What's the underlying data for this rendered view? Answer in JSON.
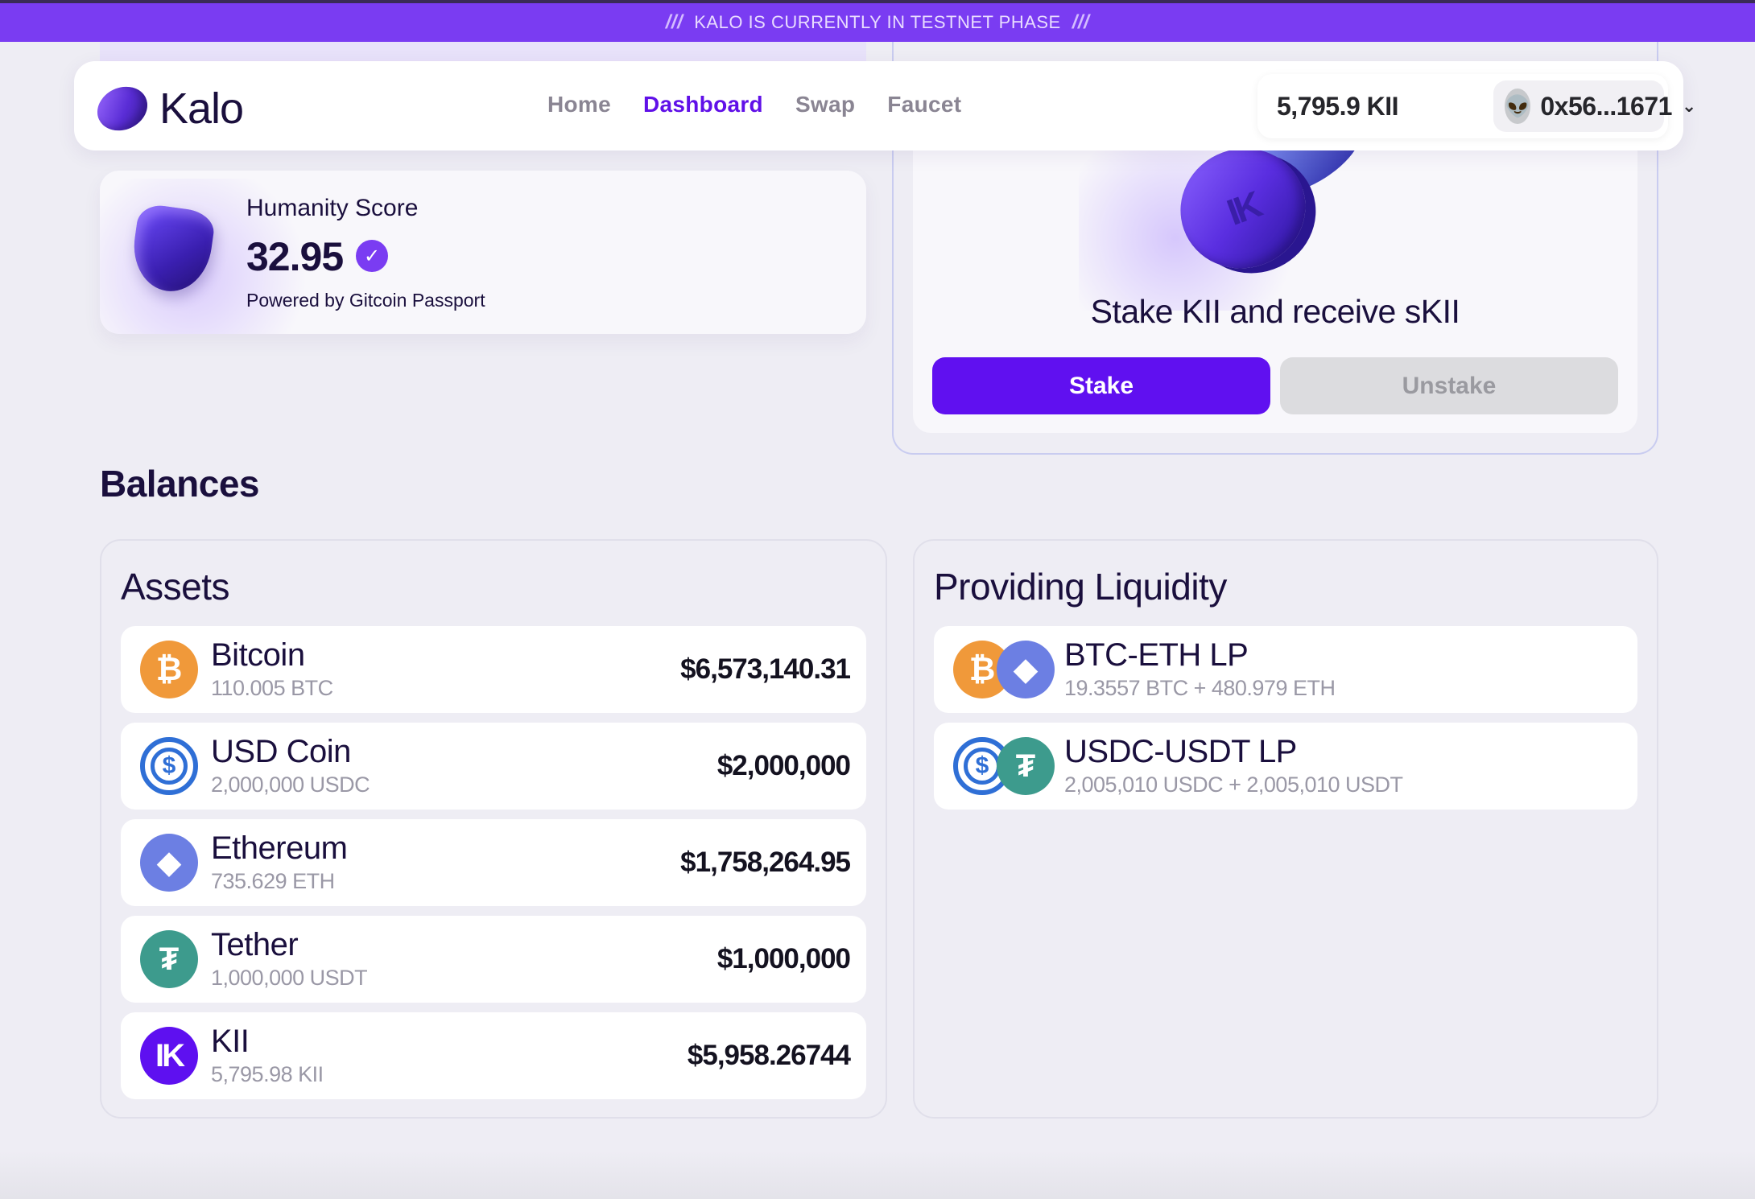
{
  "banner": {
    "text": "KALO IS CURRENTLY IN TESTNET PHASE",
    "slashes": "///"
  },
  "nav": {
    "logo_text": "Kalo",
    "links": [
      "Home",
      "Dashboard",
      "Swap",
      "Faucet"
    ],
    "active_link": "Dashboard",
    "wallet_balance": "5,795.9 KII",
    "wallet_address": "0x56...1671",
    "avatar_icon": "alien-icon"
  },
  "humanity": {
    "title": "Humanity Score",
    "score": "32.95",
    "powered_by": "Powered by Gitcoin Passport",
    "verified_icon": "verified-badge-icon"
  },
  "stake": {
    "coin_label": "IK",
    "title": "Stake KII and receive sKII",
    "stake_label": "Stake",
    "unstake_label": "Unstake"
  },
  "balances": {
    "title": "Balances",
    "assets": {
      "title": "Assets",
      "rows": [
        {
          "name": "Bitcoin",
          "amount": "110.005 BTC",
          "value": "$6,573,140.31",
          "icon": "bitcoin-icon",
          "glyph": "₿"
        },
        {
          "name": "USD Coin",
          "amount": "2,000,000 USDC",
          "value": "$2,000,000",
          "icon": "usdc-icon",
          "glyph": "$"
        },
        {
          "name": "Ethereum",
          "amount": "735.629 ETH",
          "value": "$1,758,264.95",
          "icon": "ethereum-icon",
          "glyph": "◆"
        },
        {
          "name": "Tether",
          "amount": "1,000,000 USDT",
          "value": "$1,000,000",
          "icon": "tether-icon",
          "glyph": "₮"
        },
        {
          "name": "KII",
          "amount": "5,795.98 KII",
          "value": "$5,958.26744",
          "icon": "kii-icon",
          "glyph": "IK"
        }
      ]
    },
    "liquidity": {
      "title": "Providing Liquidity",
      "rows": [
        {
          "name": "BTC-ETH LP",
          "amount": "19.3557 BTC + 480.979 ETH",
          "icon_a": "bitcoin-icon",
          "icon_b": "ethereum-icon",
          "glyph_a": "₿",
          "glyph_b": "◆"
        },
        {
          "name": "USDC-USDT LP",
          "amount": "2,005,010 USDC + 2,005,010 USDT",
          "icon_a": "usdc-icon",
          "icon_b": "tether-icon",
          "glyph_a": "$",
          "glyph_b": "₮"
        }
      ]
    }
  },
  "colors": {
    "accent": "#6010f0",
    "banner": "#7a3cf2",
    "bitcoin": "#f0993a",
    "usdc": "#2f6fd6",
    "ethereum": "#6c7fe3",
    "tether": "#3d9b8d"
  }
}
